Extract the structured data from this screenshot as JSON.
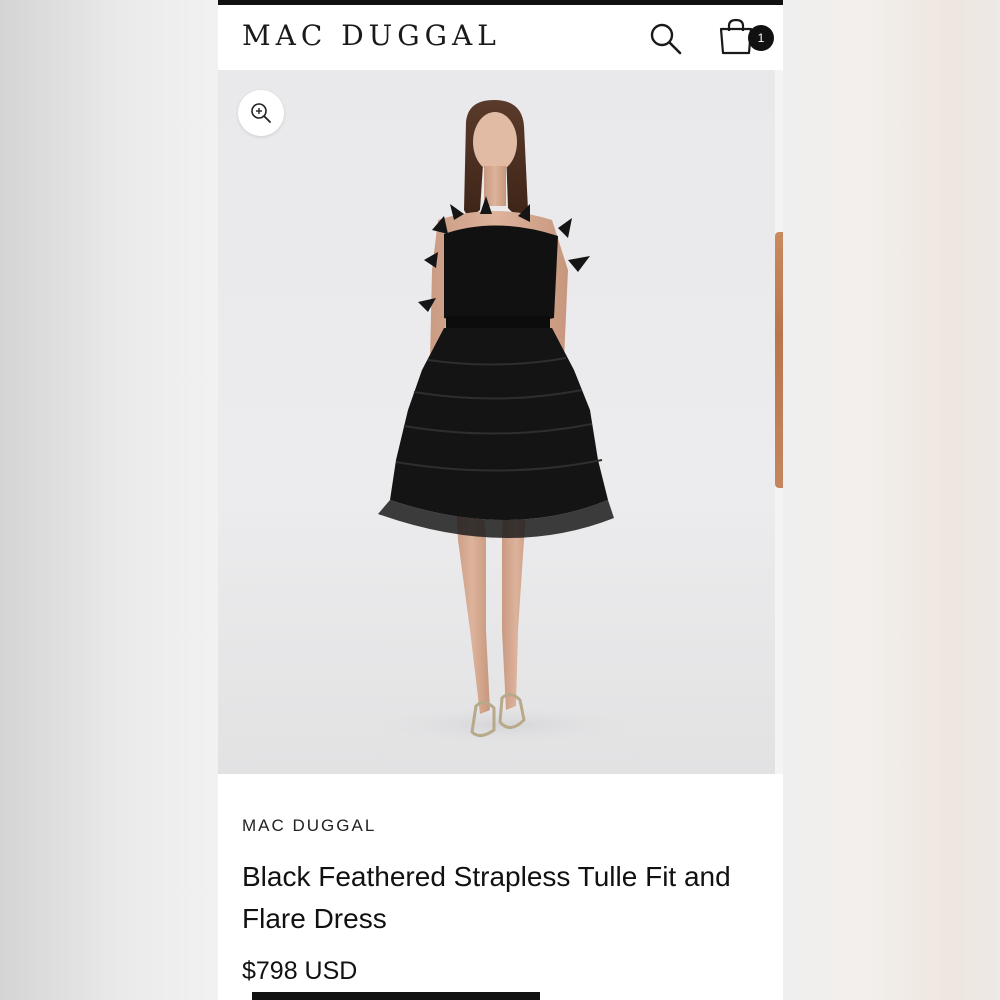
{
  "header": {
    "logo_text": "MAC DUGGAL",
    "cart_count": "1"
  },
  "icons": {
    "search": "search-icon",
    "cart": "shopping-bag-icon",
    "zoom": "zoom-in-icon"
  },
  "gallery": {
    "current_image": "Model wearing black feathered strapless tulle mini dress",
    "has_next_image": true
  },
  "product": {
    "brand": "MAC DUGGAL",
    "title": "Black Feathered Strapless Tulle Fit and Flare Dress",
    "price": "$798 USD"
  },
  "colors": {
    "text": "#111111",
    "background": "#ffffff",
    "badge": "#111111",
    "image_backdrop": "#e9e9ec"
  }
}
